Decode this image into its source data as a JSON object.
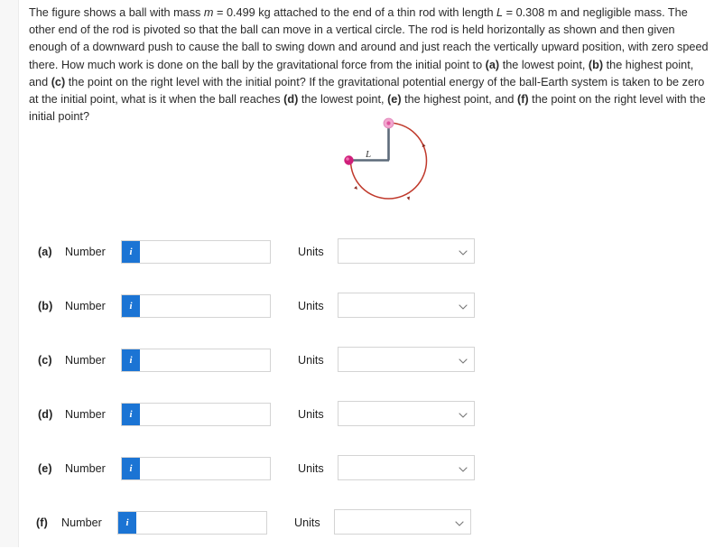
{
  "problem": {
    "segments": [
      {
        "t": "The figure shows a ball with mass ",
        "style": "normal"
      },
      {
        "t": "m",
        "style": "italic"
      },
      {
        "t": " = 0.499 kg attached to the end of a thin rod with length ",
        "style": "normal"
      },
      {
        "t": "L",
        "style": "italic"
      },
      {
        "t": " = 0.308 m and negligible mass. The other end of the rod is pivoted so that the ball can move in a vertical circle. The rod is held horizontally as shown and then given enough of a downward push to cause the ball to swing down and around and just reach the vertically upward position, with zero speed there. How much work is done on the ball by the gravitational force from the initial point to ",
        "style": "normal"
      },
      {
        "t": "(a)",
        "style": "bold"
      },
      {
        "t": " the lowest point, ",
        "style": "normal"
      },
      {
        "t": "(b)",
        "style": "bold"
      },
      {
        "t": " the highest point, and ",
        "style": "normal"
      },
      {
        "t": "(c)",
        "style": "bold"
      },
      {
        "t": " the point on the right level with the initial point? If the gravitational potential energy of the ball-Earth system is taken to be zero at the initial point, what is it when the ball reaches ",
        "style": "normal"
      },
      {
        "t": "(d)",
        "style": "bold"
      },
      {
        "t": " the lowest point, ",
        "style": "normal"
      },
      {
        "t": "(e)",
        "style": "bold"
      },
      {
        "t": " the highest point, and ",
        "style": "normal"
      },
      {
        "t": "(f)",
        "style": "bold"
      },
      {
        "t": " the point on the right level with the initial point?",
        "style": "normal"
      }
    ],
    "mass_value": "0.499 kg",
    "length_value": "0.308 m"
  },
  "figure": {
    "rod_label": "L",
    "pivot_color": "#cf1f7a",
    "ball_color": "#f2a8cf",
    "rod_color": "#5d6b7a",
    "circle_color": "#c0392b",
    "description": "ball on rod pivoted, vertical circle with direction arrows"
  },
  "rows": [
    {
      "tag": "(a)",
      "number_label": "Number",
      "info_icon": "info-icon",
      "number_value": "",
      "number_placeholder": "",
      "units_label": "Units",
      "units_selected": "",
      "units_options": [
        ""
      ]
    },
    {
      "tag": "(b)",
      "number_label": "Number",
      "info_icon": "info-icon",
      "number_value": "",
      "number_placeholder": "",
      "units_label": "Units",
      "units_selected": "",
      "units_options": [
        ""
      ]
    },
    {
      "tag": "(c)",
      "number_label": "Number",
      "info_icon": "info-icon",
      "number_value": "",
      "number_placeholder": "",
      "units_label": "Units",
      "units_selected": "",
      "units_options": [
        ""
      ]
    },
    {
      "tag": "(d)",
      "number_label": "Number",
      "info_icon": "info-icon",
      "number_value": "",
      "number_placeholder": "",
      "units_label": "Units",
      "units_selected": "",
      "units_options": [
        ""
      ]
    },
    {
      "tag": "(e)",
      "number_label": "Number",
      "info_icon": "info-icon",
      "number_value": "",
      "number_placeholder": "",
      "units_label": "Units",
      "units_selected": "",
      "units_options": [
        ""
      ]
    },
    {
      "tag": "(f)",
      "number_label": "Number",
      "info_icon": "info-icon",
      "number_value": "",
      "number_placeholder": "",
      "units_label": "Units",
      "units_selected": "",
      "units_options": [
        ""
      ]
    }
  ],
  "icons": {
    "info": "i",
    "chevron": "chevron-down-icon"
  },
  "colors": {
    "accent_blue": "#1b74d4",
    "border_gray": "#d4d4d4",
    "gutter_gray": "#f7f7f7"
  }
}
